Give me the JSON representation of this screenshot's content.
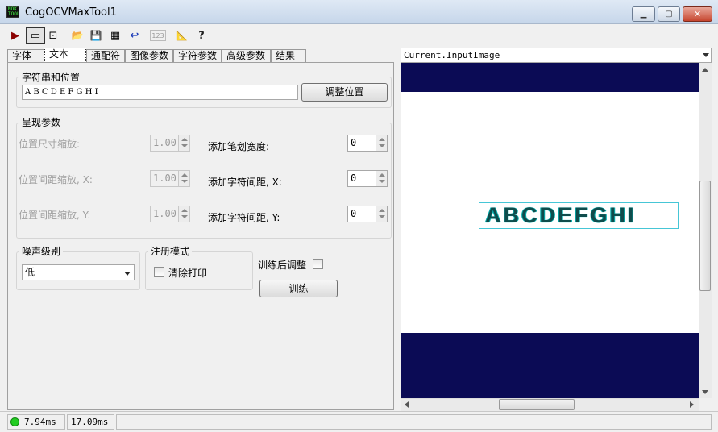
{
  "window": {
    "title": "CogOCVMaxTool1",
    "app_icon_text": "NOK\nTOOL",
    "minimize": "▁",
    "maximize": "▢",
    "close": "✕"
  },
  "toolbar": {
    "run": "▶",
    "image_pane": "▭",
    "magnify": "⊡",
    "open": "📂",
    "save": "💾",
    "settings": "▦",
    "reset": "↩",
    "numeric": "123",
    "edit": "📐",
    "help": "?"
  },
  "tabs": [
    "字体",
    "文本",
    "通配符",
    "图像参数",
    "字符参数",
    "高级参数",
    "结果"
  ],
  "string_position": {
    "legend": "字符串和位置",
    "value": "A B C D E F G H I",
    "adjust_button": "调整位置"
  },
  "render_params": {
    "legend": "呈现参数",
    "scale_size_label": "位置尺寸缩放:",
    "scale_size_value": "1.00",
    "scale_spacing_x_label": "位置间距缩放, X:",
    "scale_spacing_x_value": "1.00",
    "scale_spacing_y_label": "位置间距缩放, Y:",
    "scale_spacing_y_value": "1.00",
    "stroke_width_label": "添加笔划宽度:",
    "stroke_width_value": "0",
    "char_spacing_x_label": "添加字符间距, X:",
    "char_spacing_x_value": "0",
    "char_spacing_y_label": "添加字符间距, Y:",
    "char_spacing_y_value": "0"
  },
  "noise": {
    "legend": "噪声级别",
    "selected": "低"
  },
  "register_mode": {
    "legend": "注册模式",
    "clear_print_label": "清除打印",
    "clear_print_checked": false
  },
  "train": {
    "adjust_after_label": "训练后调整",
    "adjust_after_checked": false,
    "train_button": "训练"
  },
  "image_display": {
    "selector": "Current.InputImage",
    "ocv_text": "ABCDEFGHI",
    "colors": {
      "band": "#0b0b55",
      "roi": "#46c6d6",
      "glyph": "#0f4c4c"
    }
  },
  "status": {
    "indicator_color": "#22cc22",
    "time1": "7.94ms",
    "time2": "17.09ms"
  }
}
